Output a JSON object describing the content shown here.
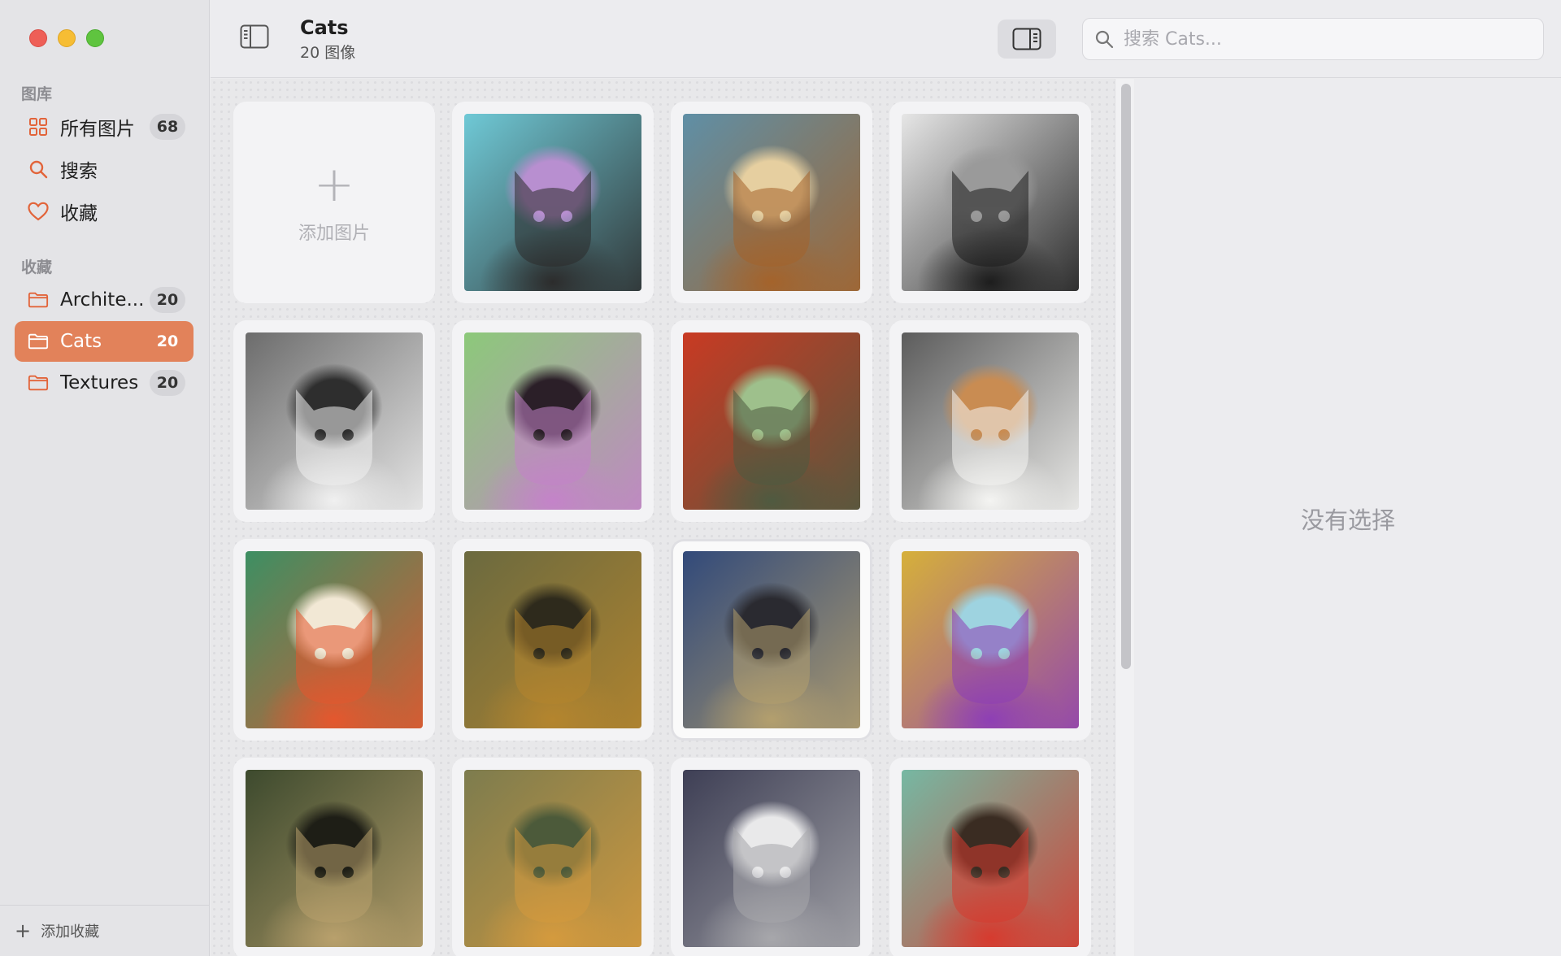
{
  "sidebar": {
    "library_title": "图库",
    "library_items": [
      {
        "label": "所有图片",
        "count": "68",
        "icon": "grid-icon"
      },
      {
        "label": "搜索",
        "icon": "search-icon"
      },
      {
        "label": "收藏",
        "icon": "heart-icon"
      }
    ],
    "collections_title": "收藏",
    "collections": [
      {
        "label": "Archite...",
        "count": "20",
        "icon": "folder-icon"
      },
      {
        "label": "Cats",
        "count": "20",
        "icon": "folder-icon",
        "selected": true
      },
      {
        "label": "Textures",
        "count": "20",
        "icon": "folder-icon"
      }
    ],
    "add_collection": "添加收藏"
  },
  "toolbar": {
    "title": "Cats",
    "subtitle": "20 图像",
    "search_placeholder": "搜索 Cats..."
  },
  "grid": {
    "add_label": "添加图片",
    "images": [
      {
        "desc": "graffiti cat",
        "palette": [
          "#6fc9d6",
          "#2c2c2c",
          "#b88fd0"
        ]
      },
      {
        "desc": "tabby cat painting",
        "palette": [
          "#5f8fa6",
          "#a4632b",
          "#e6cfa0"
        ]
      },
      {
        "desc": "linocut cat",
        "palette": [
          "#e6e6e6",
          "#1d1d1d",
          "#9a9a9a"
        ]
      },
      {
        "desc": "low-poly cat",
        "palette": [
          "#6c6c6c",
          "#f0f0f0",
          "#2e2e2e"
        ]
      },
      {
        "desc": "neon cat",
        "palette": [
          "#8cc97a",
          "#c483c9",
          "#2b1f28"
        ]
      },
      {
        "desc": "expressionist cat",
        "palette": [
          "#c93a23",
          "#4f5a40",
          "#9ec08c"
        ]
      },
      {
        "desc": "origami cat",
        "palette": [
          "#5c5c5c",
          "#f4f4f2",
          "#c98c52"
        ]
      },
      {
        "desc": "matisse cat",
        "palette": [
          "#3d8f63",
          "#e4572e",
          "#f2e8d5"
        ]
      },
      {
        "desc": "renaissance cat",
        "palette": [
          "#6b6a3f",
          "#b4852e",
          "#2e2a1c"
        ]
      },
      {
        "desc": "pearl earring cat",
        "palette": [
          "#324a7a",
          "#b39f6e",
          "#2a2a30"
        ]
      },
      {
        "desc": "astronaut cat",
        "palette": [
          "#d6b03a",
          "#8e3fb5",
          "#9ed3e0"
        ]
      },
      {
        "desc": "close-up cat photo",
        "palette": [
          "#3d4a2e",
          "#b8a06c",
          "#1e1e16"
        ]
      },
      {
        "desc": "klimt cat",
        "palette": [
          "#7d7c4e",
          "#d49a3e",
          "#4c5a3a"
        ]
      },
      {
        "desc": "tuxedo cat",
        "palette": [
          "#3e3f55",
          "#a7a7ab",
          "#e9e9ea"
        ]
      },
      {
        "desc": "frida cat",
        "palette": [
          "#76b8a3",
          "#d63b2f",
          "#3a2c22"
        ]
      }
    ],
    "selected_index": 9
  },
  "inspector": {
    "empty_text": "没有选择"
  }
}
